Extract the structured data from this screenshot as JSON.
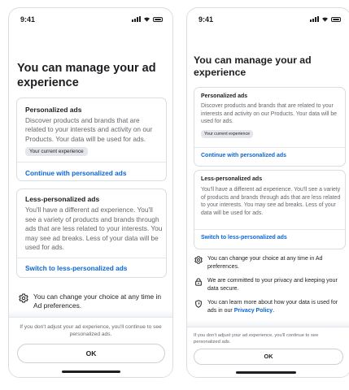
{
  "left": {
    "status": {
      "time": "9:41"
    },
    "title": "You can manage your ad experience",
    "personalized": {
      "heading": "Personalized ads",
      "description": "Discover products and brands that are related to your interests and activity on our Products. Your data will be used for ads.",
      "badge": "Your current experience",
      "action": "Continue with personalized ads"
    },
    "less_personalized": {
      "heading": "Less-personalized ads",
      "description": "You'll have a different ad experience. You'll see a variety of products and brands through ads that are less related to your interests. You may see ad breaks. Less of your data will be used for ads.",
      "action": "Switch to less-personalized ads"
    },
    "notes": [
      {
        "icon": "gear-icon",
        "text": "You can change your choice at any time in Ad preferences."
      }
    ],
    "footer": {
      "text": "If you don't adjust your ad experience, you'll continue to see personalized ads.",
      "ok_label": "OK"
    }
  },
  "right": {
    "status": {
      "time": "9:41"
    },
    "title": "You can manage your ad experience",
    "personalized": {
      "heading": "Personalized ads",
      "description": "Discover products and brands that are related to your interests and activity on our Products. Your data will be used for ads.",
      "badge": "Your current experience",
      "action": "Continue with personalized ads"
    },
    "less_personalized": {
      "heading": "Less-personalized ads",
      "description": "You'll have a different ad experience. You'll see a variety of products and brands through ads that are less related to your interests. You may see ad breaks. Less of your data will be used for ads.",
      "action": "Switch to less-personalized ads"
    },
    "notes": [
      {
        "icon": "gear-icon",
        "text": "You can change your choice at any time in Ad preferences."
      },
      {
        "icon": "lock-icon",
        "text": "We are committed to your privacy and keeping your data secure."
      },
      {
        "icon": "shield-icon",
        "text": "You can learn more about how your data is used for ads in our",
        "link": "Privacy Policy",
        "suffix": "."
      }
    ],
    "footer": {
      "text": "If you don't adjust your ad experience, you'll continue to see personalized ads.",
      "ok_label": "OK"
    }
  },
  "colors": {
    "link": "#0a66d8",
    "text_primary": "#1c1e21",
    "text_secondary": "#65676b",
    "badge_bg": "#e4e6eb",
    "border": "#dadde1"
  }
}
